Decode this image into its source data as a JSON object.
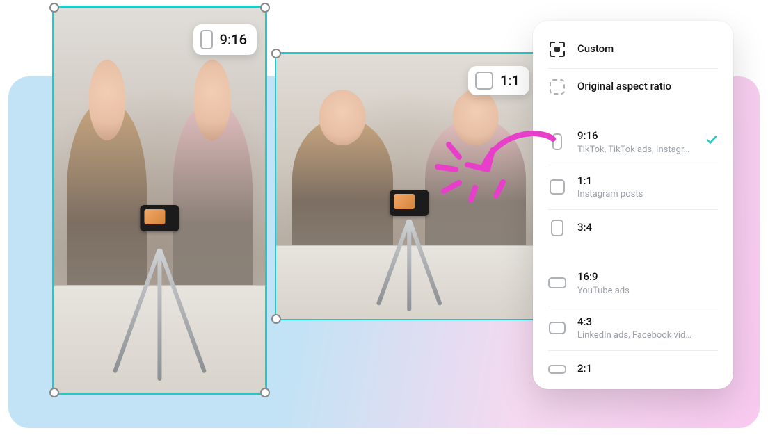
{
  "frames": {
    "portrait": {
      "ratio_label": "9:16"
    },
    "square": {
      "ratio_label": "1:1"
    }
  },
  "panel": {
    "custom_label": "Custom",
    "original_label": "Original aspect ratio",
    "ratios": [
      {
        "label": "9:16",
        "sub": "TikTok, TikTok ads, Instagr…",
        "selected": true
      },
      {
        "label": "1:1",
        "sub": "Instagram posts",
        "selected": false
      },
      {
        "label": "3:4",
        "sub": "",
        "selected": false
      },
      {
        "label": "16:9",
        "sub": "YouTube ads",
        "selected": false
      },
      {
        "label": "4:3",
        "sub": "LinkedIn ads, Facebook vid…",
        "selected": false
      },
      {
        "label": "2:1",
        "sub": "",
        "selected": false
      }
    ]
  },
  "colors": {
    "accent": "#21c9c9",
    "annotation": "#e83fcb"
  }
}
